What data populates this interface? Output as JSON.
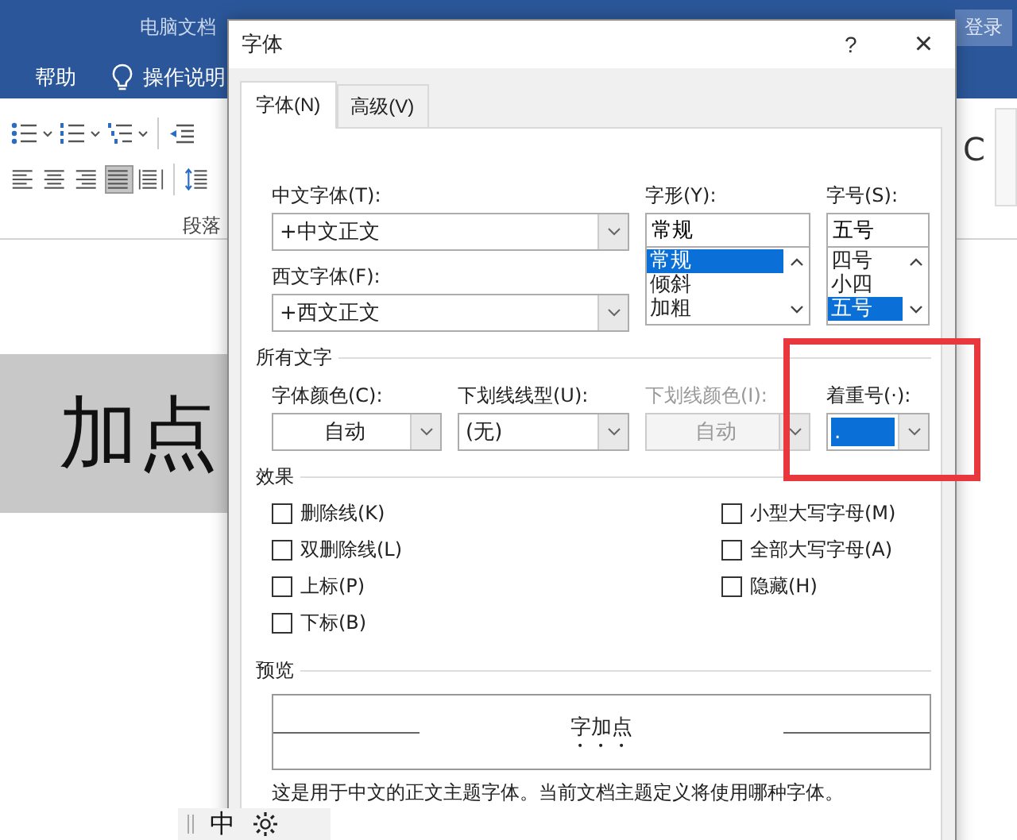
{
  "word_window": {
    "title": "电脑文档",
    "login_button": "登录",
    "ribbon_tabs": [
      {
        "label": "帮助",
        "kind": "plain"
      },
      {
        "label": "操作说明",
        "kind": "tell-me"
      }
    ],
    "list_tools": [
      {
        "kind": "bullets"
      },
      {
        "kind": "numbering"
      },
      {
        "kind": "multilevel"
      },
      {
        "kind": "outdent"
      }
    ],
    "align_tools": [
      {
        "kind": "left",
        "selected": false
      },
      {
        "kind": "center",
        "selected": false
      },
      {
        "kind": "right",
        "selected": false
      },
      {
        "kind": "justify",
        "selected": true
      },
      {
        "kind": "distributed",
        "selected": false
      },
      {
        "kind": "spacing",
        "selected": false
      }
    ],
    "group_label": "段落",
    "styles_fragment": "C",
    "document_text": "加点",
    "ime_label": "中"
  },
  "dialog": {
    "title": "字体",
    "help": "?",
    "close": "×",
    "tabs": [
      {
        "label": "字体(N)",
        "selected": true
      },
      {
        "label": "高级(V)",
        "selected": false
      }
    ],
    "chinese_font": {
      "label": "中文字体(T):",
      "value": "+中文正文"
    },
    "western_font": {
      "label": "西文字体(F):",
      "value": "+西文正文"
    },
    "style": {
      "label": "字形(Y):",
      "value": "常规",
      "options": [
        {
          "label": "常规",
          "selected": true
        },
        {
          "label": "倾斜",
          "selected": false
        },
        {
          "label": "加粗",
          "selected": false
        }
      ]
    },
    "size": {
      "label": "字号(S):",
      "value": "五号",
      "options": [
        {
          "label": "四号",
          "selected": false
        },
        {
          "label": "小四",
          "selected": false
        },
        {
          "label": "五号",
          "selected": true
        }
      ]
    },
    "all_text": {
      "title": "所有文字",
      "fields": [
        {
          "label": "字体颜色(C):",
          "value": "自动",
          "kind": "color",
          "disabled": false
        },
        {
          "label": "下划线线型(U):",
          "value": "(无)",
          "kind": "list",
          "disabled": false
        },
        {
          "label": "下划线颜色(I):",
          "value": "自动",
          "kind": "color",
          "disabled": true
        },
        {
          "label": "着重号(·):",
          "value": ".",
          "kind": "emphasis",
          "disabled": false
        }
      ]
    },
    "effects": {
      "title": "效果",
      "left": [
        {
          "label": "删除线(K)",
          "checked": false
        },
        {
          "label": "双删除线(L)",
          "checked": false
        },
        {
          "label": "上标(P)",
          "checked": false
        },
        {
          "label": "下标(B)",
          "checked": false
        }
      ],
      "right": [
        {
          "label": "小型大写字母(M)",
          "checked": false
        },
        {
          "label": "全部大写字母(A)",
          "checked": false
        },
        {
          "label": "隐藏(H)",
          "checked": false
        }
      ]
    },
    "preview": {
      "title": "预览",
      "sample": "字加点"
    },
    "description": "这是用于中文的正文主题字体。当前文档主题定义将使用哪种字体。"
  }
}
